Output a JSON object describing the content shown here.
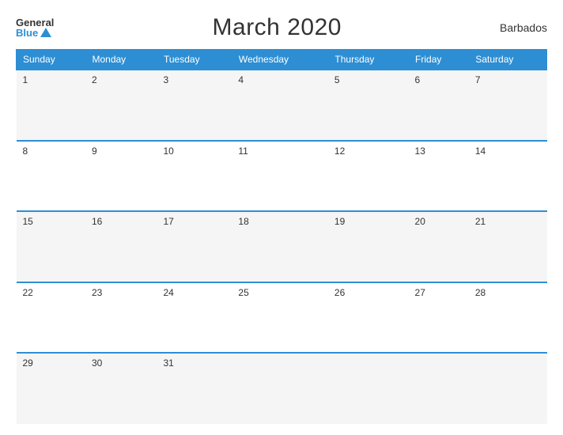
{
  "header": {
    "logo_general": "General",
    "logo_blue": "Blue",
    "title": "March 2020",
    "region": "Barbados"
  },
  "weekdays": [
    "Sunday",
    "Monday",
    "Tuesday",
    "Wednesday",
    "Thursday",
    "Friday",
    "Saturday"
  ],
  "weeks": [
    [
      "1",
      "2",
      "3",
      "4",
      "5",
      "6",
      "7"
    ],
    [
      "8",
      "9",
      "10",
      "11",
      "12",
      "13",
      "14"
    ],
    [
      "15",
      "16",
      "17",
      "18",
      "19",
      "20",
      "21"
    ],
    [
      "22",
      "23",
      "24",
      "25",
      "26",
      "27",
      "28"
    ],
    [
      "29",
      "30",
      "31",
      "",
      "",
      "",
      ""
    ]
  ]
}
